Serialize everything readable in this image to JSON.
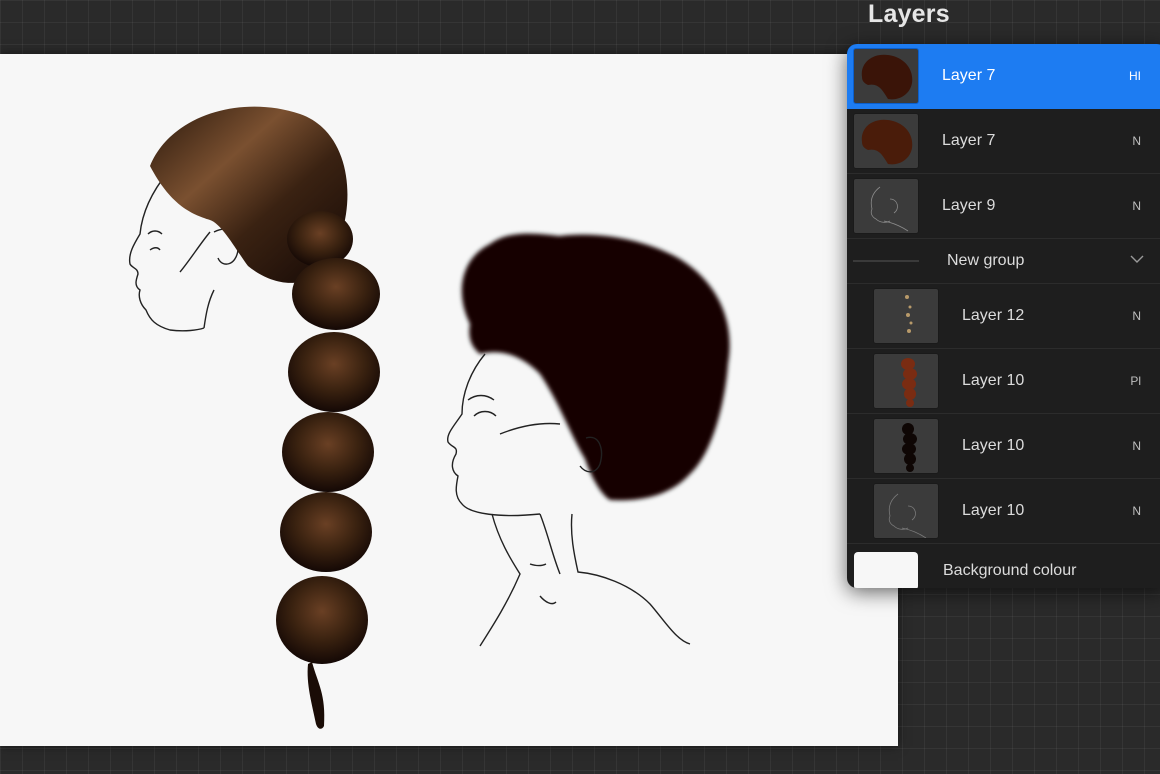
{
  "panel": {
    "title": "Layers"
  },
  "layers": [
    {
      "name": "Layer 7",
      "mode": "HI",
      "selected": true,
      "thumb": "afro-hair-thumbnail"
    },
    {
      "name": "Layer 7",
      "mode": "N",
      "selected": false,
      "thumb": "afro-hair-thumbnail"
    },
    {
      "name": "Layer 9",
      "mode": "N",
      "selected": false,
      "thumb": "sketch-thumbnail"
    }
  ],
  "group": {
    "name": "New group",
    "icon": "chevron-down-icon"
  },
  "group_layers": [
    {
      "name": "Layer 12",
      "mode": "N",
      "thumb": "ponytail-highlights-thumbnail"
    },
    {
      "name": "Layer 10",
      "mode": "Pl",
      "thumb": "ponytail-brown-thumbnail"
    },
    {
      "name": "Layer 10",
      "mode": "N",
      "thumb": "ponytail-dark-thumbnail"
    },
    {
      "name": "Layer 10",
      "mode": "N",
      "thumb": "sketch-thumbnail"
    }
  ],
  "background": {
    "name": "Background colour",
    "color": "#f7f7f7"
  },
  "colors": {
    "accent": "#1d7cf2",
    "panel": "#1e1e1e",
    "hair_dark": "#1a0a05",
    "hair_brown": "#4a2a14"
  }
}
